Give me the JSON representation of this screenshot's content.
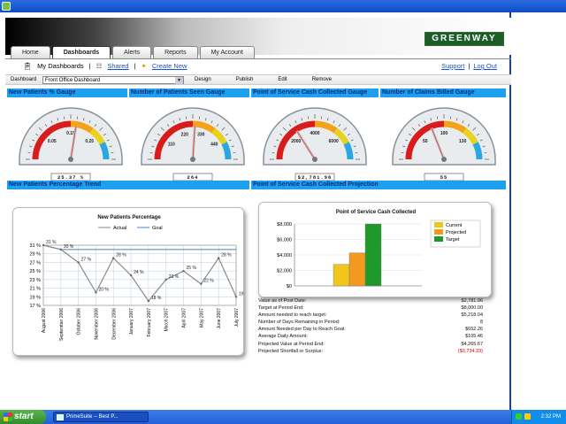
{
  "header": {
    "logo": "GREENWAY"
  },
  "tabs": [
    {
      "label": "Home"
    },
    {
      "label": "Dashboards",
      "active": true
    },
    {
      "label": "Alerts"
    },
    {
      "label": "Reports"
    },
    {
      "label": "My Account"
    }
  ],
  "subbar": {
    "my_dashboards": "My Dashboards",
    "sep1": "|",
    "shared": "Shared",
    "sep2": "|",
    "create_new": "Create New",
    "support": "Support",
    "sep3": "|",
    "logout": "Log Out"
  },
  "toolbar": {
    "dashboard_label": "Dashboard",
    "dashboard_value": "Front Office Dashboard",
    "design": "Design",
    "publish": "Publish",
    "edit": "Edit",
    "remove": "Remove"
  },
  "panels": {
    "p1": "New Patients % Gauge",
    "p2": "Number of Patients Seen Gauge",
    "p3": "Point of Service Cash Collected Gauge",
    "p4": "Number of Claims Billed Gauge",
    "p5": "New Patients Percentage Trend",
    "p6": "Point of Service Cash Collected Projection"
  },
  "gauges": [
    {
      "ticks": [
        "0.05",
        "0.15",
        "0.25"
      ],
      "readout": "25.37 %",
      "needle": 0.55
    },
    {
      "ticks": [
        "110",
        "220",
        "330",
        "440"
      ],
      "readout": "264",
      "needle": 0.52
    },
    {
      "ticks": [
        "2000",
        "4000",
        "6000"
      ],
      "readout": "$2,781.96",
      "needle": 0.32
    },
    {
      "ticks": [
        "50",
        "100",
        "130"
      ],
      "readout": "55",
      "needle": 0.38
    }
  ],
  "chart_data": [
    {
      "type": "line",
      "title": "New Patients Percentage",
      "legend": [
        "Actual",
        "Goal"
      ],
      "categories": [
        "August 2006",
        "September 2006",
        "October 2006",
        "November 2006",
        "December 2006",
        "January 2007",
        "February 2007",
        "March 2007",
        "April 2007",
        "May 2007",
        "June 2007",
        "July 2007"
      ],
      "series": [
        {
          "name": "Actual",
          "values": [
            31,
            30,
            27,
            20,
            28,
            24,
            18,
            23,
            25,
            22,
            28,
            19
          ],
          "labels": [
            "31 %",
            "30 %",
            "27 %",
            "20 %",
            "28 %",
            "24 %",
            "18 %",
            "23 %",
            "25 %",
            "22 %",
            "28 %",
            "19 %"
          ]
        },
        {
          "name": "Goal",
          "values": [
            31,
            30,
            30,
            30,
            30,
            30,
            30,
            30,
            30,
            30,
            30,
            30
          ]
        }
      ],
      "ylim": [
        17,
        31
      ],
      "yticks": [
        "31 %",
        "29 %",
        "27 %",
        "25 %",
        "23 %",
        "21 %",
        "19 %",
        "17 %"
      ]
    },
    {
      "type": "bar",
      "title": "Point of Service Cash Collected",
      "categories": [
        "Current",
        "Projected",
        "Target"
      ],
      "values": [
        2781.96,
        4265.67,
        8000
      ],
      "colors": [
        "#f2c51a",
        "#f39a1e",
        "#1f9a2a"
      ],
      "ylim": [
        0,
        8000
      ],
      "yticks": [
        "$8,000",
        "$6,000",
        "$4,000",
        "$2,000",
        "$0"
      ]
    }
  ],
  "stats": [
    {
      "label": "Value as of Post Date:",
      "value": "$2,781.96"
    },
    {
      "label": "Target at Period End:",
      "value": "$8,000.00"
    },
    {
      "label": "Amount needed to reach target:",
      "value": "$5,218.04"
    },
    {
      "label": "Number of Days Remaining in Period:",
      "value": "8"
    },
    {
      "label": "Amount Needed per Day to Reach Goal:",
      "value": "$652.26"
    },
    {
      "label": "Average Daily Amount:",
      "value": "$105.46"
    },
    {
      "label": "Projected Value at Period End:",
      "value": "$4,265.67"
    },
    {
      "label": "Projected Shortfall or Surplus:",
      "value": "($3,734.33)"
    }
  ],
  "taskbar": {
    "start": "start",
    "task": "PrimeSuite -- Best P...",
    "time": "2:32 PM"
  }
}
